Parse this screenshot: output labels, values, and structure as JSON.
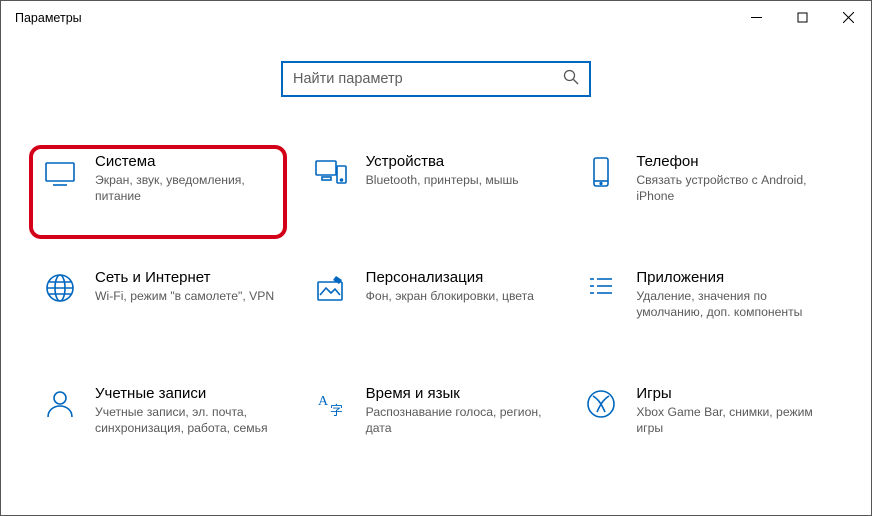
{
  "window": {
    "title": "Параметры"
  },
  "search": {
    "placeholder": "Найти параметр"
  },
  "tiles": [
    {
      "title": "Система",
      "desc": "Экран, звук, уведомления, питание"
    },
    {
      "title": "Устройства",
      "desc": "Bluetooth, принтеры, мышь"
    },
    {
      "title": "Телефон",
      "desc": "Связать устройство с Android, iPhone"
    },
    {
      "title": "Сеть и Интернет",
      "desc": "Wi-Fi, режим \"в самолете\", VPN"
    },
    {
      "title": "Персонализация",
      "desc": "Фон, экран блокировки, цвета"
    },
    {
      "title": "Приложения",
      "desc": "Удаление, значения по умолчанию, доп. компоненты"
    },
    {
      "title": "Учетные записи",
      "desc": "Учетные записи, эл. почта, синхронизация, работа, семья"
    },
    {
      "title": "Время и язык",
      "desc": "Распознавание голоса, регион, дата"
    },
    {
      "title": "Игры",
      "desc": "Xbox Game Bar, снимки, режим игры"
    }
  ]
}
